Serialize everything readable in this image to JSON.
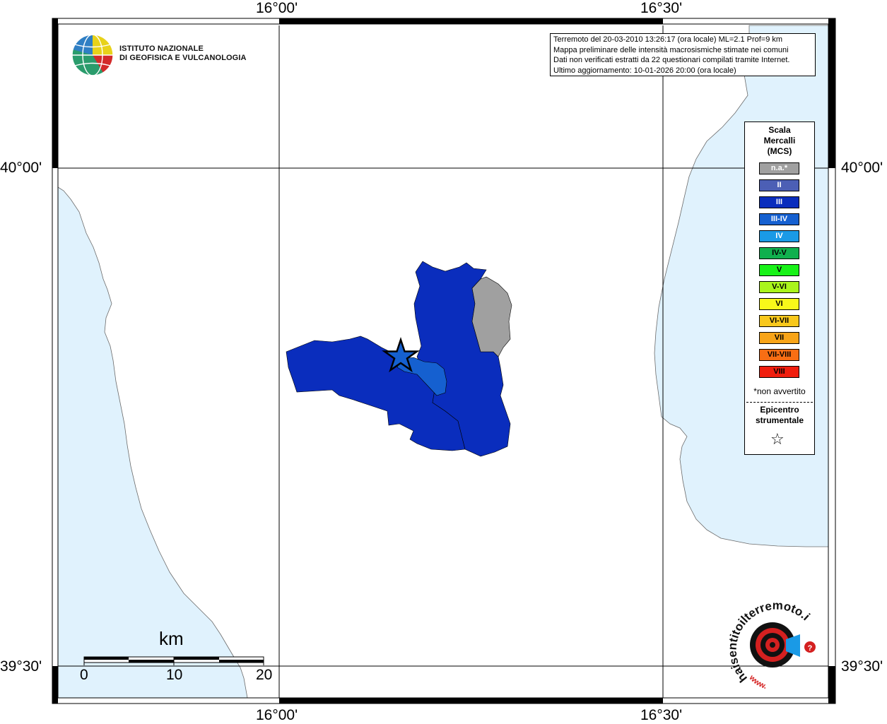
{
  "graticule": {
    "lon_labels": [
      "16°00'",
      "16°30'"
    ],
    "lat_labels": [
      "40°00'",
      "39°30'"
    ]
  },
  "logo": {
    "line1": "ISTITUTO NAZIONALE",
    "line2": "DI GEOFISICA E VULCANOLOGIA"
  },
  "info": {
    "line1": "Terremoto del 20-03-2010 13:26:17 (ora locale) ML=2.1 Prof=9 km",
    "line2": "Mappa preliminare delle intensità macrosismiche stimate nei comuni",
    "line3": "Dati non verificati estratti da 22 questionari compilati tramite Internet.",
    "line4": "Ultimo aggiornamento: 10-01-2026 20:00 (ora locale)"
  },
  "legend": {
    "title1": "Scala",
    "title2": "Mercalli",
    "title3": "(MCS)",
    "items": [
      {
        "label": "n.a.*",
        "color": "#a0a0a0",
        "text_color": "#ffffff"
      },
      {
        "label": "II",
        "color": "#4c5fb5",
        "text_color": "#ffffff"
      },
      {
        "label": "III",
        "color": "#0a2dbd",
        "text_color": "#ffffff"
      },
      {
        "label": "III-IV",
        "color": "#1560d0",
        "text_color": "#ffffff"
      },
      {
        "label": "IV",
        "color": "#1a9ae6",
        "text_color": "#ffffff"
      },
      {
        "label": "IV-V",
        "color": "#10b04e",
        "text_color": "#000000"
      },
      {
        "label": "V",
        "color": "#18f218",
        "text_color": "#000000"
      },
      {
        "label": "V-VI",
        "color": "#aaf51c",
        "text_color": "#000000"
      },
      {
        "label": "VI",
        "color": "#f8f81a",
        "text_color": "#000000"
      },
      {
        "label": "VI-VII",
        "color": "#f8c81c",
        "text_color": "#000000"
      },
      {
        "label": "VII",
        "color": "#f8a418",
        "text_color": "#000000"
      },
      {
        "label": "VII-VIII",
        "color": "#f86e14",
        "text_color": "#000000"
      },
      {
        "label": "VIII",
        "color": "#f01e0e",
        "text_color": "#000000"
      }
    ],
    "note": "*non avvertito",
    "epicenter1": "Epicentro",
    "epicenter2": "strumentale",
    "star": "☆"
  },
  "scalebar": {
    "unit": "km",
    "labels": [
      "0",
      "10",
      "20"
    ]
  },
  "branding": {
    "text": "haisentitoilterremoto.it",
    "prefix": "www."
  },
  "colors": {
    "sea": "#e0f2fd",
    "land": "#ffffff",
    "intensity_III": "#0a2dbd",
    "intensity_III_IV": "#1560d0",
    "not_available": "#a0a0a0"
  }
}
